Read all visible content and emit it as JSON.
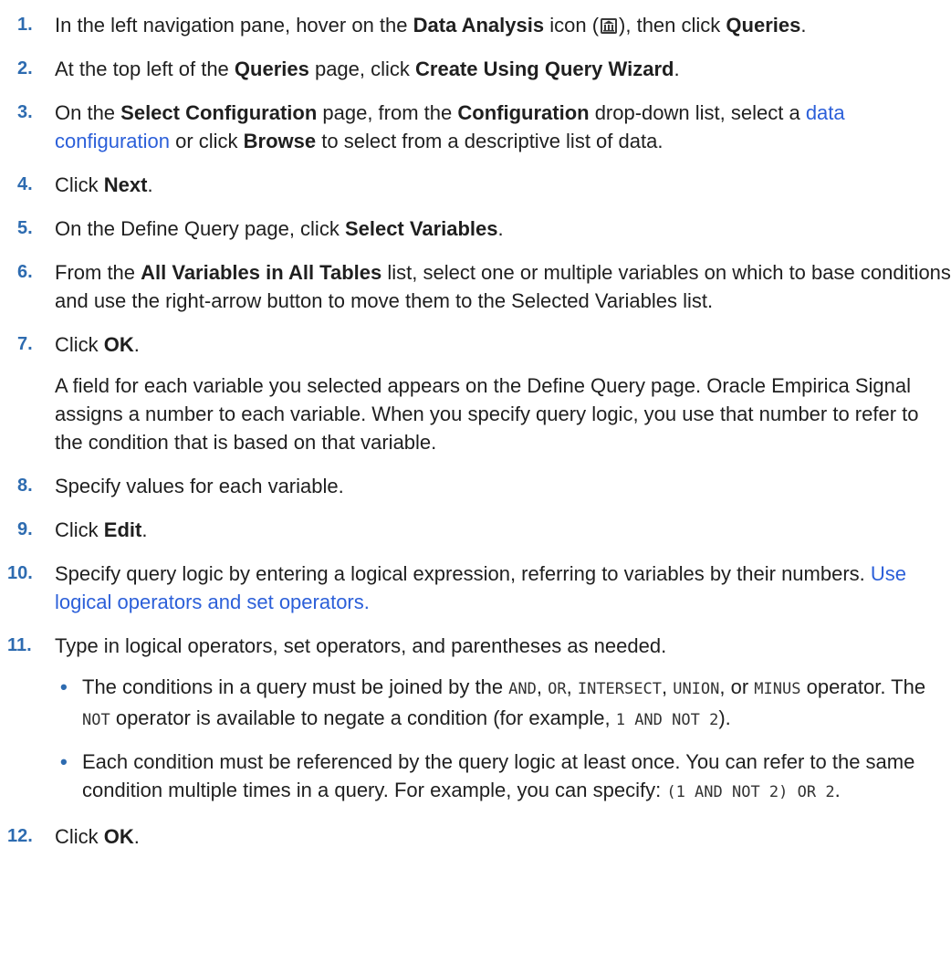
{
  "steps": [
    {
      "num": "1.",
      "t1": "In the left navigation pane, hover on the ",
      "b1": "Data Analysis",
      "t2": " icon (",
      "icon": "data-analysis-icon",
      "t3": "), then click ",
      "b2": "Queries",
      "t4": "."
    },
    {
      "num": "2.",
      "t1": "At the top left of the ",
      "b1": "Queries",
      "t2": " page, click ",
      "b2": "Create Using Query Wizard",
      "t3": "."
    },
    {
      "num": "3.",
      "t1": "On the ",
      "b1": "Select Configuration",
      "t2": " page, from the ",
      "b2": "Configuration",
      "t3": " drop-down list, select a ",
      "link": "data configuration",
      "t4": " or click ",
      "b3": "Browse",
      "t5": " to select from a descriptive list of data."
    },
    {
      "num": "4.",
      "t1": "Click ",
      "b1": "Next",
      "t2": "."
    },
    {
      "num": "5.",
      "t1": "On the Define Query page, click ",
      "b1": "Select Variables",
      "t2": "."
    },
    {
      "num": "6.",
      "t1": "From the ",
      "b1": "All Variables in All Tables",
      "t2": " list, select one or multiple variables on which to base conditions and use the right-arrow button to move them to the Selected Variables list."
    },
    {
      "num": "7.",
      "t1": "Click ",
      "b1": "OK",
      "t2": ".",
      "para": "A field for each variable you selected appears on the Define Query page. Oracle Empirica Signal assigns a number to each variable. When you specify query logic, you use that number to refer to the condition that is based on that variable."
    },
    {
      "num": "8.",
      "t1": "Specify values for each variable."
    },
    {
      "num": "9.",
      "t1": "Click ",
      "b1": "Edit",
      "t2": "."
    },
    {
      "num": "10.",
      "t1": "Specify query logic by entering a logical expression, referring to variables by their numbers. ",
      "link": "Use logical operators and set operators."
    },
    {
      "num": "11.",
      "t1": "Type in logical operators, set operators, and parentheses as needed.",
      "bullet_marker": "•",
      "bullets": [
        {
          "t1": "The conditions in a query must be joined by the ",
          "c1": "AND",
          "t2": ", ",
          "c2": "OR",
          "t3": ", ",
          "c3": "INTERSECT",
          "t4": ", ",
          "c4": "UNION",
          "t5": ", or ",
          "c5": "MINUS",
          "t6": " operator. The ",
          "c6": "NOT",
          "t7": " operator is available to negate a condition (for example, ",
          "c7": "1 AND NOT 2",
          "t8": ")."
        },
        {
          "t1": "Each condition must be referenced by the query logic at least once. You can refer to the same condition multiple times in a query. For example, you can specify: ",
          "c1": "(1 AND NOT 2) OR 2",
          "t2": "."
        }
      ]
    },
    {
      "num": "12.",
      "t1": "Click ",
      "b1": "OK",
      "t2": "."
    }
  ],
  "colors": {
    "number": "#2d6bb0",
    "link": "#2b5fd9",
    "text": "#1f1f1f"
  }
}
